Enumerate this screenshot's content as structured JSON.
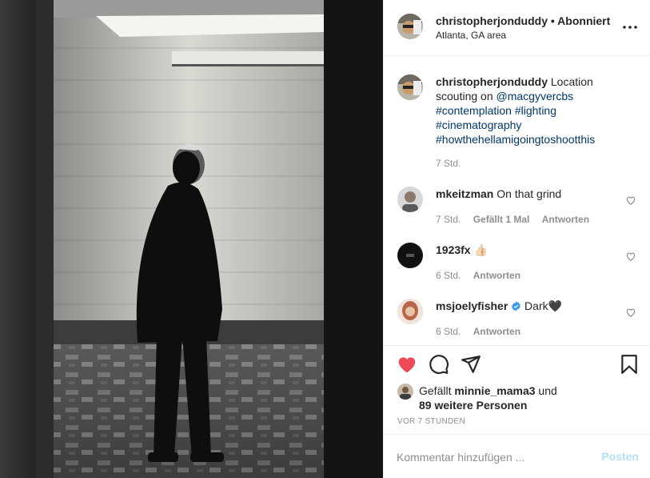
{
  "header": {
    "username": "christopherjonduddy",
    "separator": "•",
    "follow_status": "Abonniert",
    "location": "Atlanta, GA area",
    "more_icon": "more-horizontal-icon"
  },
  "caption": {
    "username": "christopherjonduddy",
    "text": "Location scouting on",
    "mention": "@macgyvercbs",
    "hashtags": [
      "#contemplation",
      "#lighting",
      "#cinematography",
      "#howthehellamigoingtoshootthis"
    ],
    "time": "7 Std."
  },
  "comments": [
    {
      "username": "mkeitzman",
      "text": "On that grind",
      "time": "7 Std.",
      "likes": "Gefällt 1 Mal",
      "reply": "Antworten"
    },
    {
      "username": "1923fx",
      "text": "👍🏻",
      "time": "6 Std.",
      "likes": "",
      "reply": "Antworten"
    },
    {
      "username": "msjoelyfisher",
      "verified": true,
      "text": "Dark🖤",
      "time": "6 Std.",
      "likes": "",
      "reply": "Antworten"
    }
  ],
  "actions": {
    "like_icon": "heart-filled-icon",
    "comment_icon": "comment-icon",
    "share_icon": "paper-plane-icon",
    "save_icon": "bookmark-icon",
    "like_color": "#ed4956"
  },
  "likes": {
    "prefix": "Gefällt",
    "user": "minnie_mama3",
    "conj": "und",
    "others": "89 weitere Personen"
  },
  "timestamp": "VOR 7 STUNDEN",
  "add_comment": {
    "placeholder": "Kommentar hinzufügen ...",
    "post_label": "Posten"
  }
}
